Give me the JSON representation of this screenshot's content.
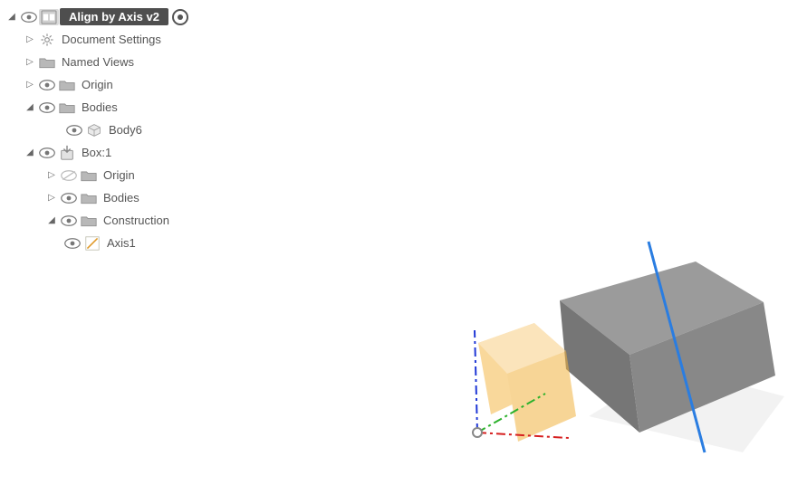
{
  "tree": {
    "root": {
      "label": "Align by Axis v2"
    },
    "docSettings": {
      "label": "Document Settings"
    },
    "namedViews": {
      "label": "Named Views"
    },
    "origin": {
      "label": "Origin"
    },
    "bodies": {
      "label": "Bodies"
    },
    "body6": {
      "label": "Body6"
    },
    "box1": {
      "label": "Box:1"
    },
    "boxOrigin": {
      "label": "Origin"
    },
    "boxBodies": {
      "label": "Bodies"
    },
    "construction": {
      "label": "Construction"
    },
    "axis1": {
      "label": "Axis1"
    }
  }
}
